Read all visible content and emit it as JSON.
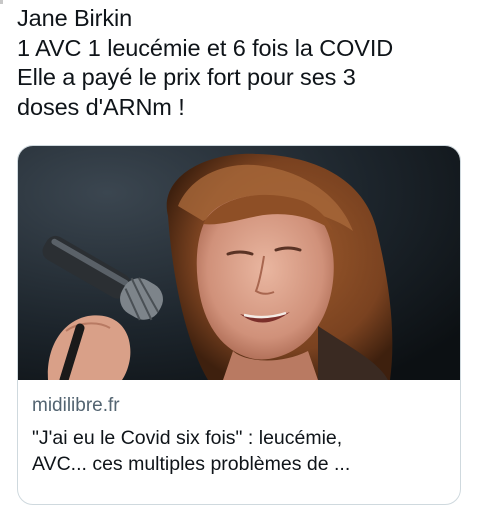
{
  "tweet": {
    "lines": [
      "Jane Birkin",
      "1 AVC 1 leucémie et 6 fois la COVID",
      "Elle a payé le prix fort pour ses 3",
      "doses d'ARNm !"
    ]
  },
  "card": {
    "image_description": "photo of a woman singing into a microphone",
    "domain": "midilibre.fr",
    "title_lines": [
      "\"J'ai eu le Covid six fois\" : leucémie,",
      "AVC... ces multiples problèmes de ..."
    ]
  },
  "colors": {
    "text": "#0f1419",
    "secondary": "#536471",
    "border": "#cfd9de"
  }
}
